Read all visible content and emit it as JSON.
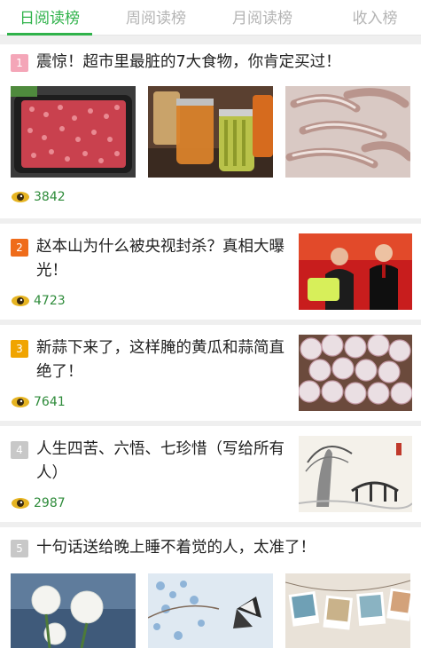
{
  "tabs": [
    "日阅读榜",
    "周阅读榜",
    "月阅读榜",
    "收入榜"
  ],
  "active_tab": 0,
  "colors": {
    "accent": "#2fb24a",
    "rank_1": "#f4a6b8",
    "rank_2": "#ef6c1a",
    "rank_3": "#f0a400",
    "rank_4": "#c8c8c8",
    "rank_5": "#c8c8c8",
    "views_text": "#2e8b3a"
  },
  "articles": [
    {
      "rank": "1",
      "title": "震惊！超市里最脏的7大食物，你肯定买过！",
      "views": "3842",
      "images": [
        "ground-meat-photo",
        "pickled-vegetables-jars-photo",
        "raw-shrimp-photo"
      ]
    },
    {
      "rank": "2",
      "title": "赵本山为什么被央视封杀？真相大曝光！",
      "views": "4723",
      "images": [
        "two-performers-on-stage-photo"
      ]
    },
    {
      "rank": "3",
      "title": "新蒜下来了，这样腌的黄瓜和蒜简直绝了！",
      "views": "7641",
      "images": [
        "garlic-bulbs-photo"
      ]
    },
    {
      "rank": "4",
      "title": "人生四苦、六悟、七珍惜（写给所有人）",
      "views": "2987",
      "images": [
        "ink-landscape-painting"
      ]
    },
    {
      "rank": "5",
      "title": "十句话送给晚上睡不着觉的人，太准了！",
      "views": "",
      "images": [
        "white-flowers-photo",
        "blue-blossom-butterfly-photo",
        "hanging-polaroids-photo"
      ]
    }
  ]
}
